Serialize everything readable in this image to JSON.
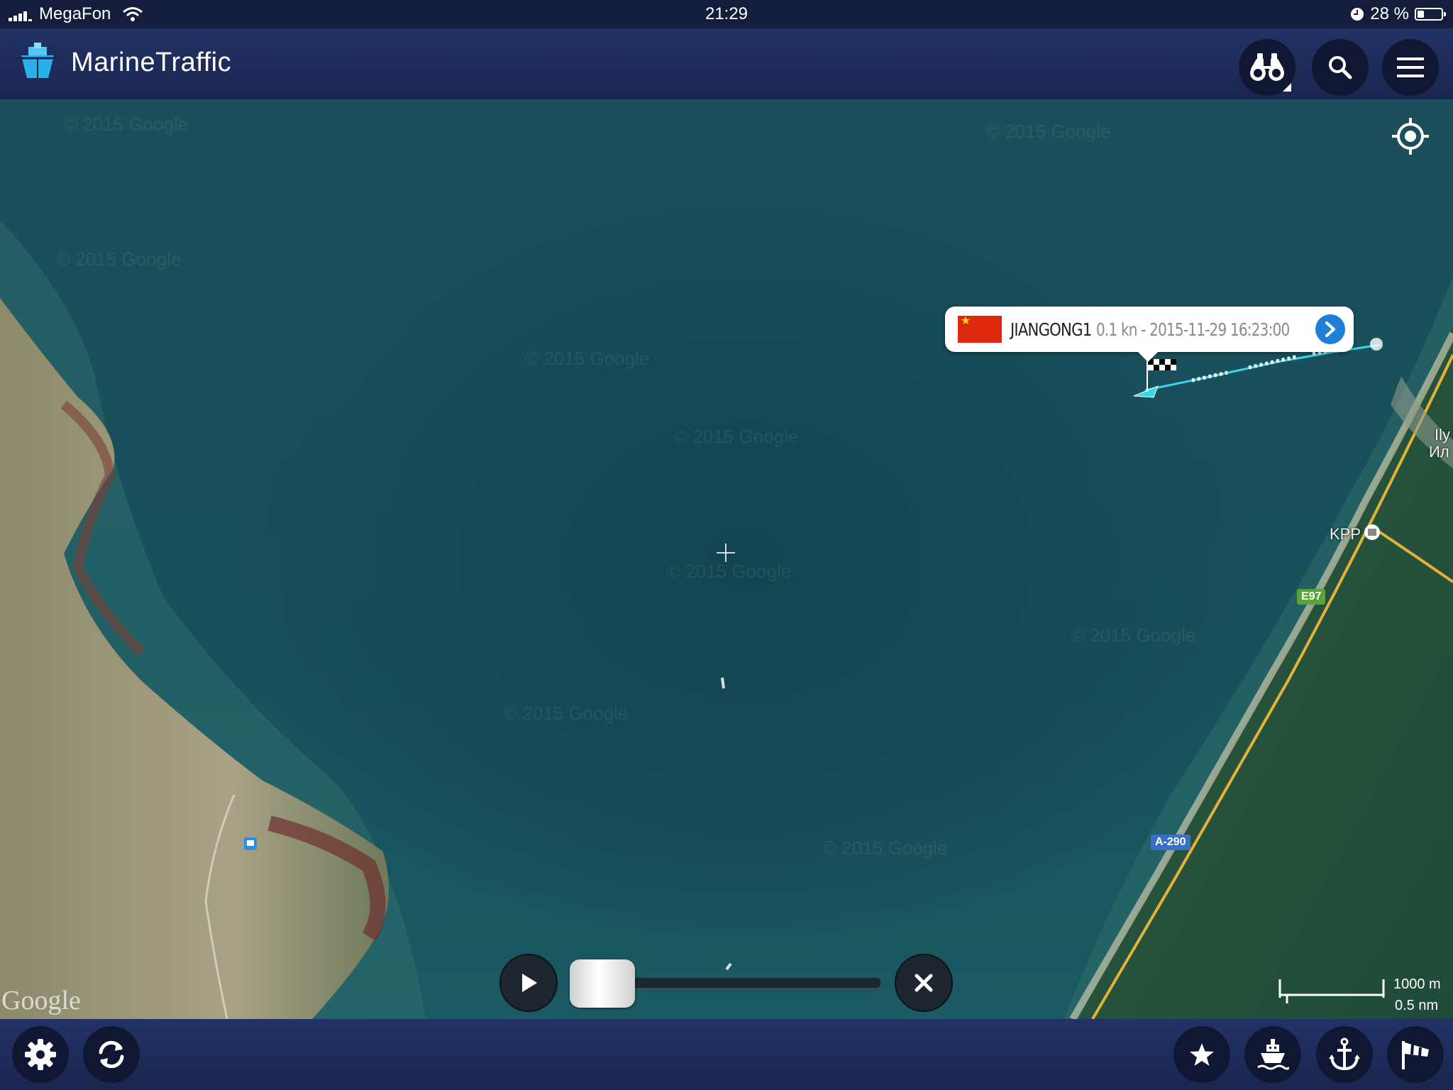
{
  "status_bar": {
    "carrier": "MegaFon",
    "time": "21:29",
    "battery": "28 %"
  },
  "app": {
    "name": "MarineTraffic"
  },
  "vessel_popup": {
    "name": "JIANGONG1",
    "info": "0.1 kn - 2015-11-29 16:23:00",
    "flag": "China"
  },
  "map": {
    "google_logo": "Google",
    "watermark": "© 2015 Google",
    "labels": {
      "kpp": "KPP",
      "e97": "E97",
      "a290": "A-290",
      "place_lat": "Ily",
      "place_cyr": "Ил"
    },
    "scale": {
      "metric": "1000 m",
      "nautical": "0.5 nm"
    }
  },
  "playback": {
    "progress": 0
  },
  "colors": {
    "nav": "#1a2650",
    "button": "#0f1733",
    "accent": "#1f7fd8",
    "track": "#38d6e8"
  }
}
